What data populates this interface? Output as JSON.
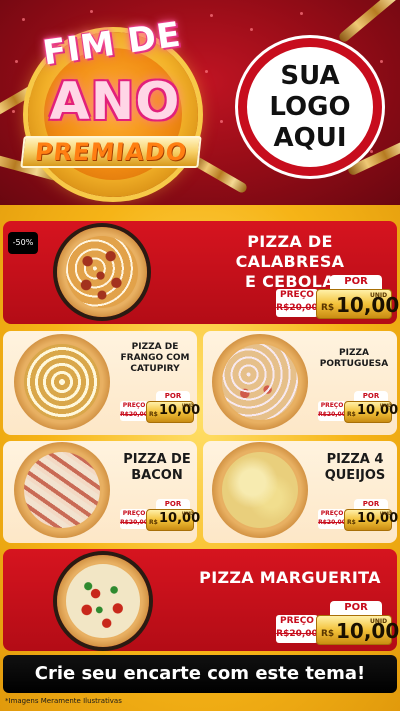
{
  "header": {
    "title_line1": "FIM DE",
    "title_line2": "ANO",
    "title_line3": "PREMIADO",
    "logo_line1": "SUA",
    "logo_line2": "LOGO",
    "logo_line3": "AQUI"
  },
  "products": [
    {
      "name_line1": "PIZZA DE CALABRESA",
      "name_line2": "E CEBOLA",
      "discount": "-50%",
      "por": "POR",
      "preco": "PREÇO",
      "old": "R$20,00",
      "currency": "R$",
      "value": "10,00",
      "unit": "UNID"
    },
    {
      "name_line1": "PIZZA DE",
      "name_line2": "FRANGO COM",
      "name_line3": "CATUPIRY",
      "por": "POR",
      "preco": "PREÇO",
      "old": "R$20,00",
      "currency": "R$",
      "value": "10,00",
      "unit": "UNID"
    },
    {
      "name_line1": "PIZZA",
      "name_line2": "PORTUGUESA",
      "por": "POR",
      "preco": "PREÇO",
      "old": "R$20,00",
      "currency": "R$",
      "value": "10,00",
      "unit": "UNID"
    },
    {
      "name_line1": "PIZZA DE",
      "name_line2": "BACON",
      "por": "POR",
      "preco": "PREÇO",
      "old": "R$20,00",
      "currency": "R$",
      "value": "10,00",
      "unit": "UNID"
    },
    {
      "name_line1": "PIZZA 4",
      "name_line2": "QUEIJOS",
      "por": "POR",
      "preco": "PREÇO",
      "old": "R$20,00",
      "currency": "R$",
      "value": "10,00",
      "unit": "UNID"
    },
    {
      "name_line1": "PIZZA MARGUERITA",
      "por": "POR",
      "preco": "PREÇO",
      "old": "R$20,00",
      "currency": "R$",
      "value": "10,00",
      "unit": "UNID"
    }
  ],
  "cta": "Crie seu encarte com este tema!",
  "disclaimer": "*Imagens Meramente Ilustrativas",
  "colors": {
    "red": "#c70d1d",
    "gold": "#f3c23a",
    "cream": "#fff3df",
    "black": "#000000"
  }
}
